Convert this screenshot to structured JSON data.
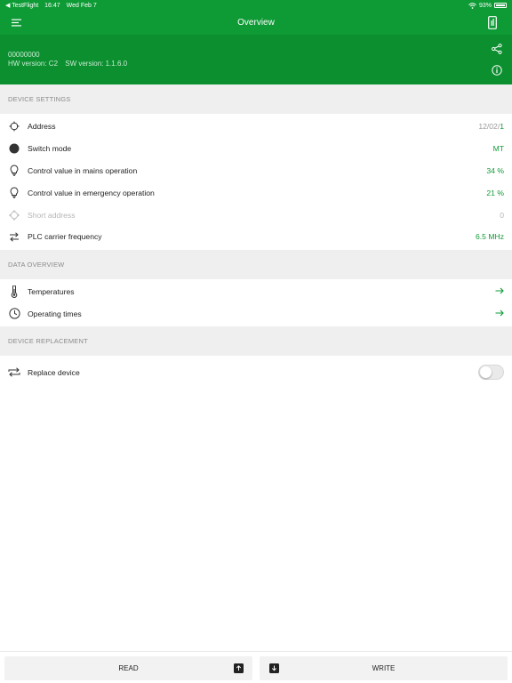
{
  "status": {
    "back_app": "◀ TestFlight",
    "time": "16:47",
    "date": "Wed Feb 7",
    "battery": "93%"
  },
  "nav": {
    "title": "Overview"
  },
  "device": {
    "serial": "00000000",
    "hw": "HW version: C2",
    "sw": "SW version: 1.1.6.0"
  },
  "sections": {
    "device_settings": "DEVICE SETTINGS",
    "data_overview": "DATA OVERVIEW",
    "device_replacement": "DEVICE REPLACEMENT"
  },
  "settings": {
    "address": {
      "label": "Address",
      "value_prefix": "12/02/",
      "value_suffix": "1"
    },
    "switch_mode": {
      "label": "Switch mode",
      "value": "MT"
    },
    "mains": {
      "label": "Control value in mains operation",
      "value": "34 %"
    },
    "emergency": {
      "label": "Control value in emergency operation",
      "value": "21 %"
    },
    "short_address": {
      "label": "Short address",
      "value": "0"
    },
    "plc": {
      "label": "PLC carrier frequency",
      "value": "6.5 MHz"
    }
  },
  "overview": {
    "temperatures": {
      "label": "Temperatures"
    },
    "operating_times": {
      "label": "Operating times"
    }
  },
  "replacement": {
    "label": "Replace device",
    "enabled": false
  },
  "actions": {
    "read": "READ",
    "write": "WRITE"
  },
  "colors": {
    "accent": "#0e9a35",
    "header": "#0b8f2f"
  }
}
